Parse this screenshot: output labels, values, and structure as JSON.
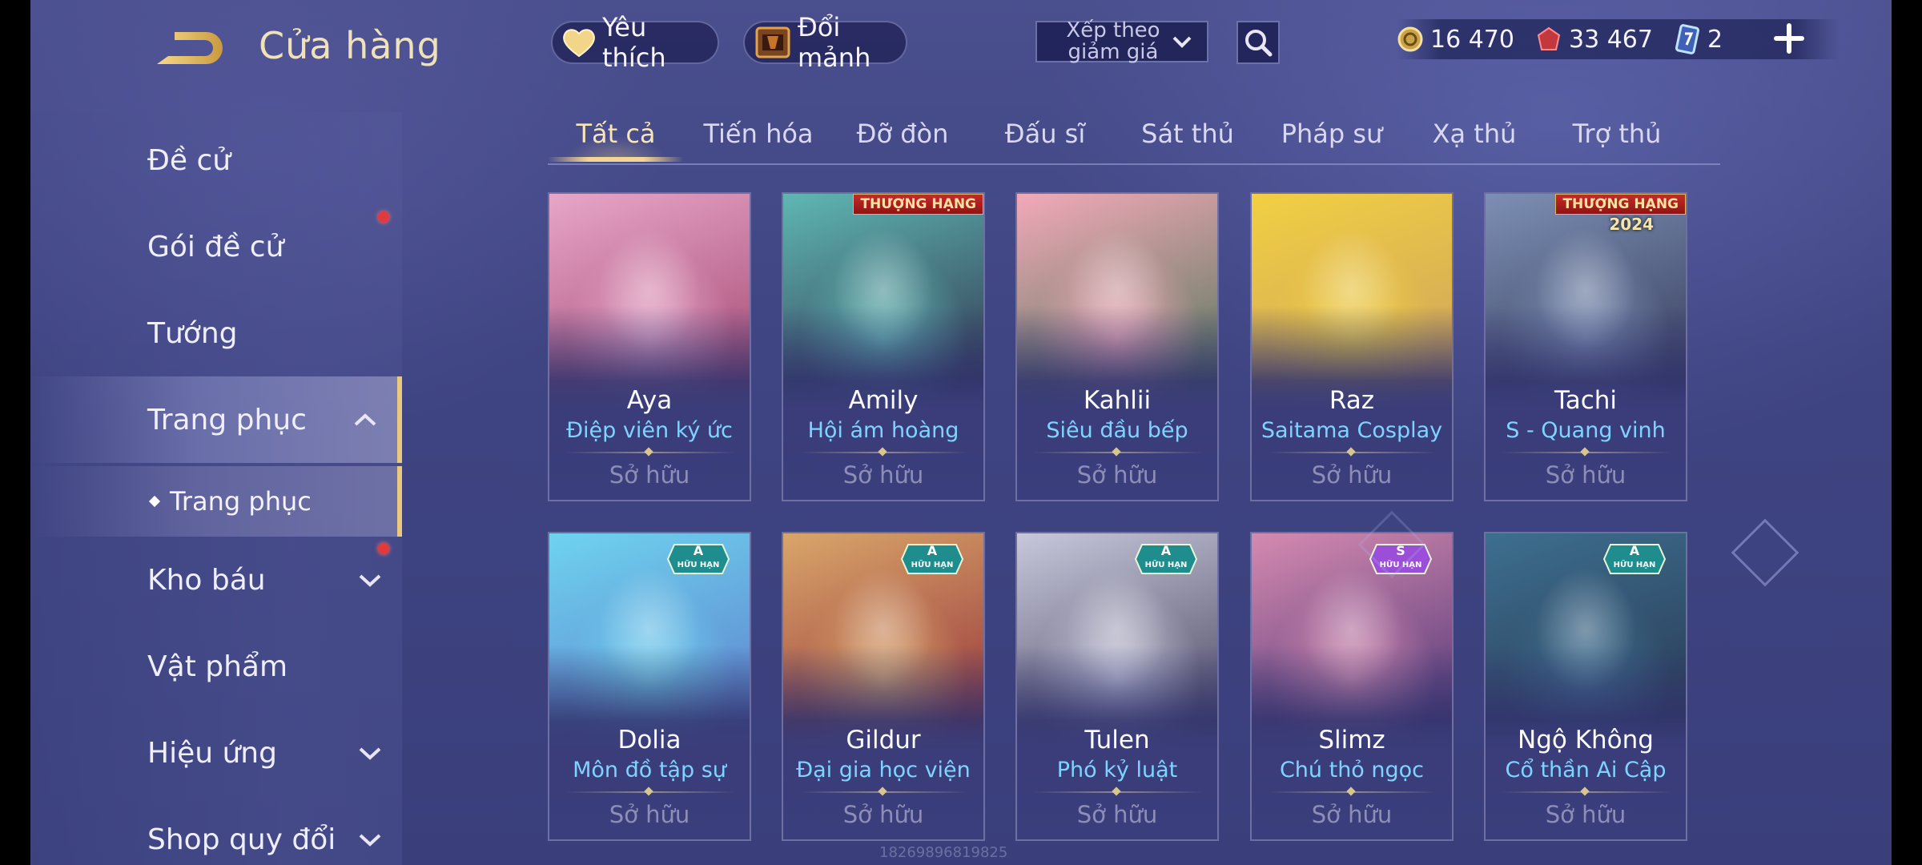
{
  "header": {
    "title": "Cửa hàng",
    "favorites_label": "Yêu thích",
    "trade_label": "Đổi mảnh",
    "sort": {
      "selected": "Xếp theo giảm giá"
    },
    "currencies": [
      {
        "icon": "gold-coin-icon",
        "value": "16 470"
      },
      {
        "icon": "red-gem-icon",
        "value": "33 467"
      },
      {
        "icon": "skin-card-icon",
        "value": "2"
      }
    ]
  },
  "sidebar": {
    "items": [
      {
        "label": "Đề cử",
        "badge": false
      },
      {
        "label": "Gói đề cử",
        "badge": true
      },
      {
        "label": "Tướng",
        "badge": false
      },
      {
        "label": "Trang phục",
        "badge": false,
        "expanded": true
      },
      {
        "label": "Kho báu",
        "badge": true
      },
      {
        "label": "Vật phẩm",
        "badge": false
      },
      {
        "label": "Hiệu ứng",
        "badge": false
      },
      {
        "label": "Shop quy đổi",
        "badge": false
      }
    ],
    "subitem": "Trang phục"
  },
  "tabs": [
    "Tất cả",
    "Tiến hóa",
    "Đỡ đòn",
    "Đấu sĩ",
    "Sát thủ",
    "Pháp sư",
    "Xạ thủ",
    "Trợ thủ"
  ],
  "active_tab": "Tất cả",
  "cards": [
    {
      "hero": "Aya",
      "skin": "Điệp viên ký ức",
      "status": "Sở hữu",
      "colors": [
        "#e7a6c9",
        "#9b3a63"
      ]
    },
    {
      "hero": "Amily",
      "skin": "Hội ám hoàng",
      "status": "Sở hữu",
      "colors": [
        "#5fb7b3",
        "#2a2340"
      ],
      "ribbon": "THƯỢNG HẠNG"
    },
    {
      "hero": "Kahlii",
      "skin": "Siêu đầu bếp",
      "status": "Sở hữu",
      "colors": [
        "#f2a9b9",
        "#3c6f4a"
      ]
    },
    {
      "hero": "Raz",
      "skin": "Saitama Cosplay",
      "status": "Sở hữu",
      "colors": [
        "#f2d043",
        "#c89a60"
      ]
    },
    {
      "hero": "Tachi",
      "skin": "S - Quang vinh",
      "status": "Sở hữu",
      "colors": [
        "#7c8fb4",
        "#2c304e"
      ],
      "ribbon": "THƯỢNG HẠNG",
      "ribbon_year": "2024"
    },
    {
      "hero": "Dolia",
      "skin": "Môn đồ tập sự",
      "status": "Sở hữu",
      "colors": [
        "#6fd3ef",
        "#5a74c9"
      ],
      "tier": "A",
      "tier_label": "HỮU HẠN"
    },
    {
      "hero": "Gildur",
      "skin": "Đại gia học viện",
      "status": "Sở hữu",
      "colors": [
        "#d9a66a",
        "#8c2233"
      ],
      "tier": "A",
      "tier_label": "HỮU HẠN"
    },
    {
      "hero": "Tulen",
      "skin": "Phó kỷ luật",
      "status": "Sở hữu",
      "colors": [
        "#c7c8dc",
        "#3a3550"
      ],
      "tier": "A",
      "tier_label": "HỮU HẠN"
    },
    {
      "hero": "Slimz",
      "skin": "Chú thỏ ngọc",
      "status": "Sở hữu",
      "colors": [
        "#d58ab0",
        "#3b2a6e"
      ],
      "tier": "S",
      "tier_label": "HỮU HẠN"
    },
    {
      "hero": "Ngộ Không",
      "skin": "Cổ thần Ai Cập",
      "status": "Sở hữu",
      "colors": [
        "#3d6f8f",
        "#26304a"
      ],
      "tier": "A",
      "tier_label": "HỮU HẠN"
    }
  ],
  "watermark": "1826989681​9825",
  "colors": {
    "accent_gold": "#f4d591",
    "skin_name": "#7fd4ff",
    "badge_red": "#e23a3a"
  }
}
